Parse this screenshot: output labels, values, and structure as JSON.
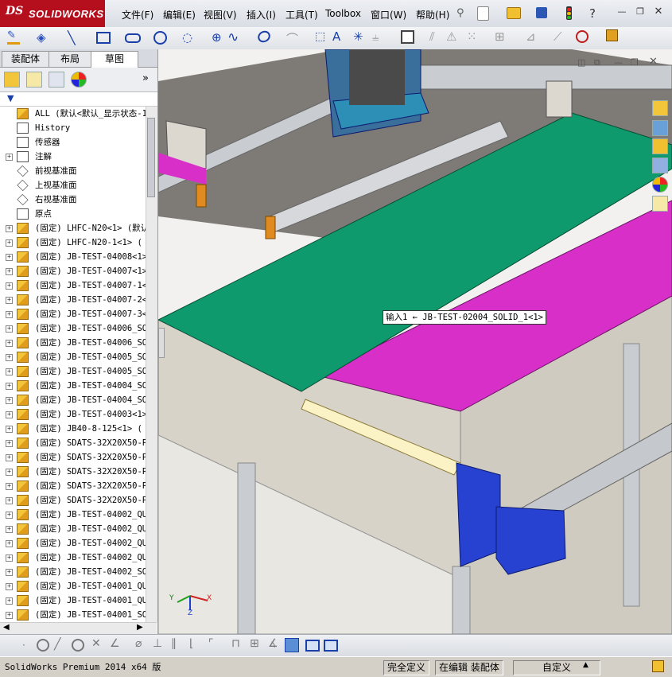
{
  "app": {
    "brand_prefix": "DS",
    "brand_name": "SOLIDWORKS"
  },
  "menu": [
    {
      "label": "文件(F)"
    },
    {
      "label": "编辑(E)"
    },
    {
      "label": "视图(V)"
    },
    {
      "label": "插入(I)"
    },
    {
      "label": "工具(T)"
    },
    {
      "label": "Toolbox"
    },
    {
      "label": "窗口(W)"
    },
    {
      "label": "帮助(H)"
    }
  ],
  "panel": {
    "tabs": [
      {
        "label": "装配体"
      },
      {
        "label": "布局"
      },
      {
        "label": "草图",
        "active": true
      }
    ],
    "tree": [
      {
        "label": "ALL  (默认<默认_显示状态-1",
        "icon": "assembly-icon",
        "expand": ""
      },
      {
        "label": "History",
        "icon": "history-icon",
        "expand": ""
      },
      {
        "label": "传感器",
        "icon": "sensor-icon",
        "expand": ""
      },
      {
        "label": "注解",
        "icon": "annotation-icon",
        "expand": "+"
      },
      {
        "label": "前视基准面",
        "icon": "plane-icon",
        "expand": ""
      },
      {
        "label": "上视基准面",
        "icon": "plane-icon",
        "expand": ""
      },
      {
        "label": "右视基准面",
        "icon": "plane-icon",
        "expand": ""
      },
      {
        "label": "原点",
        "icon": "origin-icon",
        "expand": ""
      },
      {
        "label": "(固定) LHFC-N20<1> (默认",
        "icon": "subassembly-icon",
        "expand": "+"
      },
      {
        "label": "(固定) LHFC-N20-1<1> (",
        "icon": "subassembly-icon",
        "expand": "+"
      },
      {
        "label": "(固定) JB-TEST-04008<1>",
        "icon": "subassembly-icon",
        "expand": "+"
      },
      {
        "label": "(固定) JB-TEST-04007<1>",
        "icon": "subassembly-icon",
        "expand": "+"
      },
      {
        "label": "(固定) JB-TEST-04007-1<",
        "icon": "subassembly-icon",
        "expand": "+"
      },
      {
        "label": "(固定) JB-TEST-04007-2<",
        "icon": "subassembly-icon",
        "expand": "+"
      },
      {
        "label": "(固定) JB-TEST-04007-3<",
        "icon": "subassembly-icon",
        "expand": "+"
      },
      {
        "label": "(固定) JB-TEST-04006_SO",
        "icon": "subassembly-icon",
        "expand": "+"
      },
      {
        "label": "(固定) JB-TEST-04006_SO",
        "icon": "subassembly-icon",
        "expand": "+"
      },
      {
        "label": "(固定) JB-TEST-04005_SO",
        "icon": "subassembly-icon",
        "expand": "+"
      },
      {
        "label": "(固定) JB-TEST-04005_SO",
        "icon": "subassembly-icon",
        "expand": "+"
      },
      {
        "label": "(固定) JB-TEST-04004_SO",
        "icon": "subassembly-icon",
        "expand": "+"
      },
      {
        "label": "(固定) JB-TEST-04004_SO",
        "icon": "subassembly-icon",
        "expand": "+"
      },
      {
        "label": "(固定) JB-TEST-04003<1>",
        "icon": "subassembly-icon",
        "expand": "+"
      },
      {
        "label": "(固定) JB40-8-125<1> (",
        "icon": "subassembly-icon",
        "expand": "+"
      },
      {
        "label": "(固定) SDATS-32X20X50-P",
        "icon": "subassembly-icon",
        "expand": "+"
      },
      {
        "label": "(固定) SDATS-32X20X50-P",
        "icon": "subassembly-icon",
        "expand": "+"
      },
      {
        "label": "(固定) SDATS-32X20X50-P",
        "icon": "subassembly-icon",
        "expand": "+"
      },
      {
        "label": "(固定) SDATS-32X20X50-P",
        "icon": "subassembly-icon",
        "expand": "+"
      },
      {
        "label": "(固定) SDATS-32X20X50-P",
        "icon": "subassembly-icon",
        "expand": "+"
      },
      {
        "label": "(固定) JB-TEST-04002_QU",
        "icon": "subassembly-icon",
        "expand": "+"
      },
      {
        "label": "(固定) JB-TEST-04002_QU",
        "icon": "subassembly-icon",
        "expand": "+"
      },
      {
        "label": "(固定) JB-TEST-04002_QU",
        "icon": "subassembly-icon",
        "expand": "+"
      },
      {
        "label": "(固定) JB-TEST-04002_QU",
        "icon": "subassembly-icon",
        "expand": "+"
      },
      {
        "label": "(固定) JB-TEST-04002_SO",
        "icon": "subassembly-icon",
        "expand": "+"
      },
      {
        "label": "(固定) JB-TEST-04001_QU",
        "icon": "subassembly-icon",
        "expand": "+"
      },
      {
        "label": "(固定) JB-TEST-04001_QU",
        "icon": "subassembly-icon",
        "expand": "+"
      },
      {
        "label": "(固定) JB-TEST-04001_SO",
        "icon": "subassembly-icon",
        "expand": "+"
      }
    ]
  },
  "viewport": {
    "tooltip": "输入1 ← JB-TEST-02004_SOLID_1<1>",
    "triad": {
      "x": "X",
      "y": "Y",
      "z": "Z"
    },
    "colors": {
      "green_plate": "#0e9a6c",
      "magenta_plate": "#d82fc8",
      "frame": "#d7d3c8",
      "blue_block": "#2741d0",
      "rail": "#c9ccd0"
    }
  },
  "status": {
    "product": "SolidWorks Premium 2014 x64 版",
    "definition": "完全定义",
    "mode": "在编辑 装配体",
    "units": "自定义"
  },
  "colors": {
    "brand_red": "#b50f1e",
    "tree_bg": "#ffffff",
    "chrome": "#d4d0c8"
  }
}
